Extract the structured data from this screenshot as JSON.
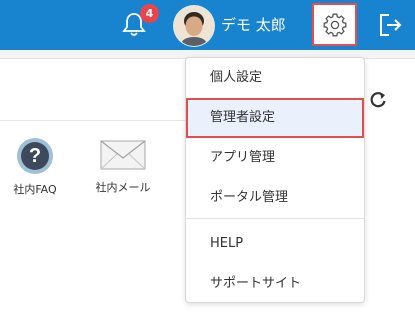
{
  "header": {
    "notification_count": "4",
    "user_name": "デモ 太郎",
    "icons": {
      "bell": "bell-icon",
      "settings": "gear-icon",
      "logout": "logout-icon"
    },
    "colors": {
      "bar": "#1883cf",
      "badge": "#e9454c",
      "highlight": "#e05050"
    }
  },
  "portal": {
    "refresh_icon": "refresh-icon",
    "apps": [
      {
        "label": "社内FAQ",
        "icon": "faq-icon"
      },
      {
        "label": "社内メール",
        "icon": "mail-icon"
      }
    ]
  },
  "settings_menu": {
    "items": [
      {
        "label": "個人設定"
      },
      {
        "label": "管理者設定",
        "selected": true
      },
      {
        "label": "アプリ管理"
      },
      {
        "label": "ポータル管理"
      },
      {
        "label": "HELP"
      },
      {
        "label": "サポートサイト"
      }
    ]
  }
}
